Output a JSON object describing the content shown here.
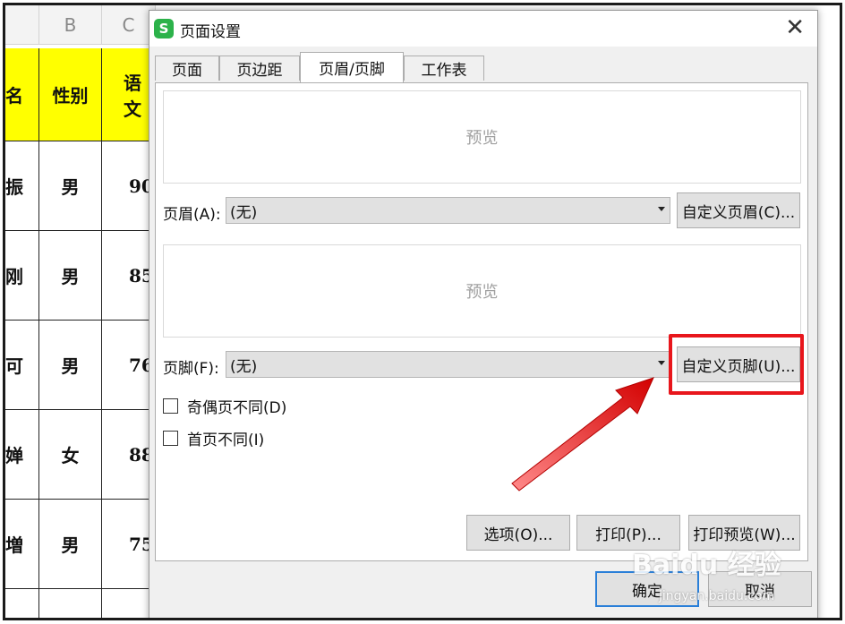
{
  "spreadsheet": {
    "col_b": "B",
    "col_c": "C",
    "headers": [
      "名",
      "性别",
      "语文"
    ],
    "rows": [
      [
        "振",
        "男",
        "90"
      ],
      [
        "刚",
        "男",
        "85"
      ],
      [
        "可",
        "男",
        "76"
      ],
      [
        "婵",
        "女",
        "88"
      ],
      [
        "増",
        "男",
        "75"
      ]
    ]
  },
  "dialog": {
    "title": "页面设置",
    "app_icon": "S",
    "close_glyph": "✕",
    "tabs": [
      "页面",
      "页边距",
      "页眉/页脚",
      "工作表"
    ],
    "active_tab": "页眉/页脚",
    "header_preview": "预览",
    "header_label": "页眉(A):",
    "header_value": "(无)",
    "custom_header_button": "自定义页眉(C)...",
    "footer_preview": "预览",
    "footer_label": "页脚(F):",
    "footer_value": "(无)",
    "custom_footer_button": "自定义页脚(U)...",
    "odd_even_checkbox": "奇偶页不同(D)",
    "first_page_checkbox": "首页不同(I)",
    "options_button": "选项(O)...",
    "print_button": "打印(P)...",
    "print_preview_button": "打印预览(W)...",
    "ok_button": "确定",
    "cancel_button": "取消"
  },
  "watermark": {
    "logo_text": "Baidu 经验",
    "url": "jingyan.baidu.com"
  },
  "colors": {
    "highlight_red": "#e8161c",
    "header_yellow": "#ffff00",
    "wps_green": "#2cb24a"
  }
}
